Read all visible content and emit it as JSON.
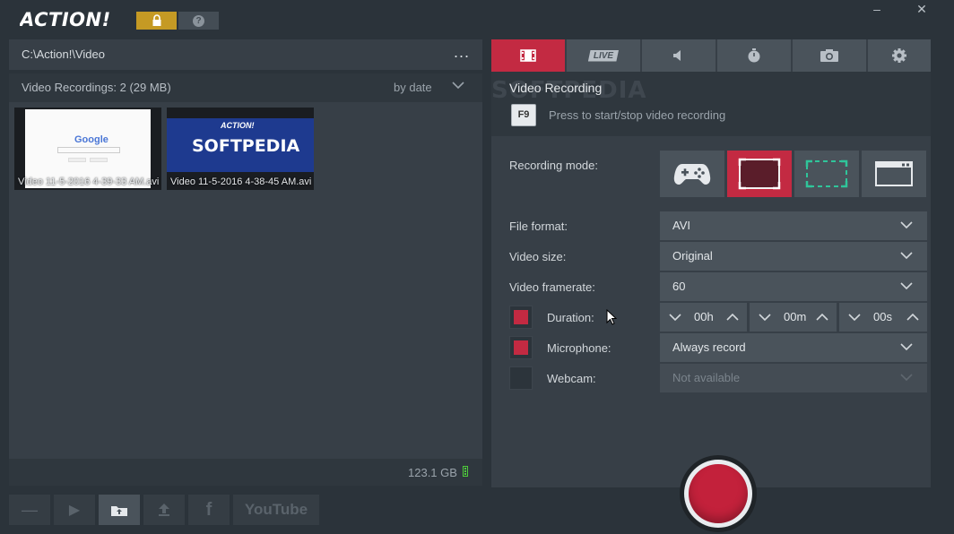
{
  "app": {
    "title": "ACTION!"
  },
  "path": {
    "current": "C:\\Action!\\Video",
    "more": "..."
  },
  "recordings": {
    "header": "Video Recordings: 2 (29 MB)",
    "sort": "by date",
    "items": [
      {
        "name": "Video 11-5-2016 4-39-33 AM.avi",
        "preview_text": "Google"
      },
      {
        "name": "Video 11-5-2016 4-38-45 AM.avi",
        "preview_text": "SOFTPEDIA",
        "preview_top": "ACTION!"
      }
    ]
  },
  "status": {
    "disk_free": "123.1 GB"
  },
  "bottom_buttons": [
    "—",
    "▶",
    "upload-folder",
    "upload",
    "facebook",
    "YouTube"
  ],
  "tabs": [
    "video",
    "LIVE",
    "audio",
    "timer",
    "screenshot",
    "settings"
  ],
  "video_panel": {
    "title": "Video Recording",
    "watermark": "SOFTPEDIA",
    "hotkey": "F9",
    "hotkey_hint": "Press to start/stop video recording",
    "recording_mode_label": "Recording mode:",
    "file_format_label": "File format:",
    "file_format": "AVI",
    "video_size_label": "Video size:",
    "video_size": "Original",
    "framerate_label": "Video framerate:",
    "framerate": "60",
    "duration_label": "Duration:",
    "duration_h": "00h",
    "duration_m": "00m",
    "duration_s": "00s",
    "microphone_label": "Microphone:",
    "microphone": "Always record",
    "webcam_label": "Webcam:",
    "webcam": "Not available"
  },
  "colors": {
    "accent": "#c32a42",
    "lock": "#c59a24",
    "disk": "#4ecb3a"
  }
}
